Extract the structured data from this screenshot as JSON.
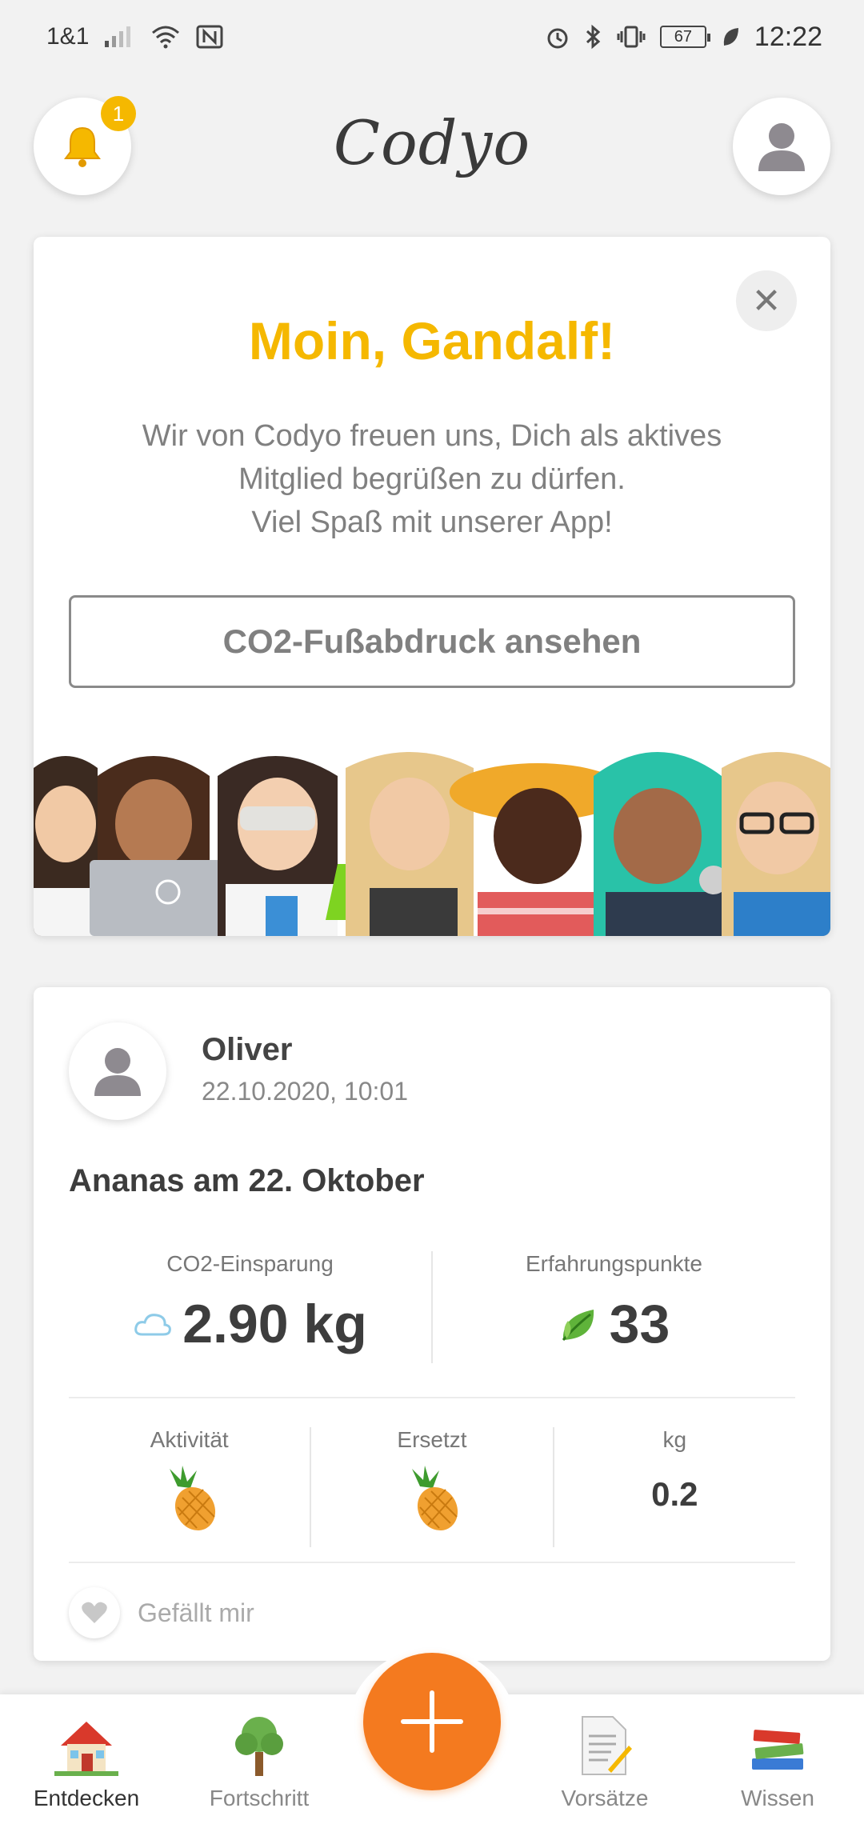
{
  "status_bar": {
    "carrier": "1&1",
    "battery": "67",
    "time": "12:22"
  },
  "header": {
    "logo": "Codyo",
    "notification_count": "1"
  },
  "welcome_card": {
    "title": "Moin, Gandalf!",
    "line1": "Wir von Codyo freuen uns, Dich als aktives",
    "line2": "Mitglied begrüßen zu dürfen.",
    "line3": "Viel Spaß mit unserer App!",
    "button_label": "CO2-Fußabdruck ansehen"
  },
  "activity_card": {
    "user_name": "Oliver",
    "date": "22.10.2020, 10:01",
    "title": "Ananas am 22. Oktober",
    "stats": {
      "co2_label": "CO2-Einsparung",
      "co2_value": "2.90 kg",
      "xp_label": "Erfahrungspunkte",
      "xp_value": "33"
    },
    "details": {
      "activity_label": "Aktivität",
      "replaced_label": "Ersetzt",
      "kg_label": "kg",
      "kg_value": "0.2"
    },
    "like_label": "Gefällt mir"
  },
  "bottom_nav": {
    "items": [
      {
        "label": "Entdecken",
        "icon": "house-icon"
      },
      {
        "label": "Fortschritt",
        "icon": "tree-icon"
      },
      {
        "label": "Vorsätze",
        "icon": "document-icon"
      },
      {
        "label": "Wissen",
        "icon": "books-icon"
      }
    ]
  },
  "colors": {
    "accent_yellow": "#f5b800",
    "fab_orange": "#f47a1f",
    "background": "#f2f2f2"
  }
}
